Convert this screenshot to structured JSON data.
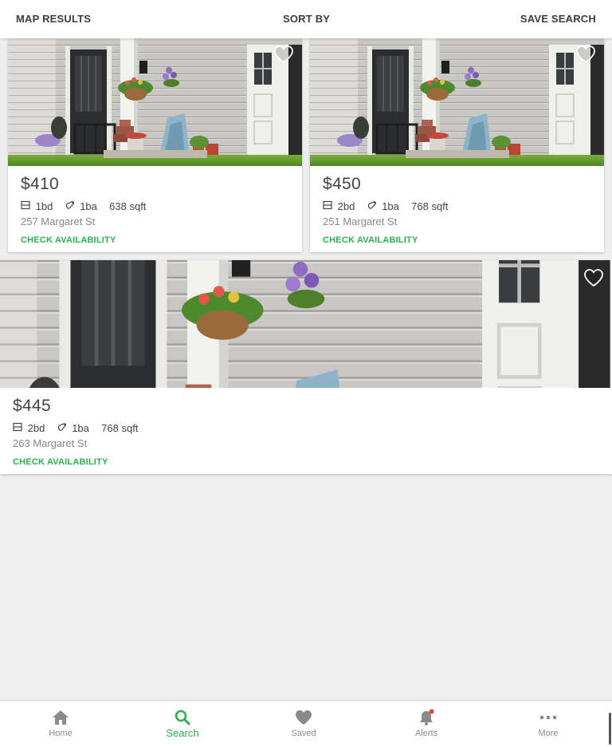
{
  "topbar": {
    "map_results": "MAP RESULTS",
    "sort_by": "SORT BY",
    "save_search": "SAVE SEARCH"
  },
  "listings": [
    {
      "price": "$410",
      "beds": "1bd",
      "baths": "1ba",
      "sqft": "638 sqft",
      "address": "257 Margaret St",
      "cta": "CHECK AVAILABILITY",
      "favorite_icon": "heart-outline-icon"
    },
    {
      "price": "$450",
      "beds": "2bd",
      "baths": "1ba",
      "sqft": "768 sqft",
      "address": "251 Margaret St",
      "cta": "CHECK AVAILABILITY",
      "favorite_icon": "heart-outline-icon"
    },
    {
      "price": "$445",
      "beds": "2bd",
      "baths": "1ba",
      "sqft": "768 sqft",
      "address": "263 Margaret St",
      "cta": "CHECK AVAILABILITY",
      "favorite_icon": "heart-outline-icon"
    }
  ],
  "bottom_nav": {
    "items": [
      {
        "label": "Home",
        "icon": "home-icon"
      },
      {
        "label": "Search",
        "icon": "search-icon",
        "active": true
      },
      {
        "label": "Saved",
        "icon": "heart-icon"
      },
      {
        "label": "Alerts",
        "icon": "bell-icon",
        "has_notification_dot": true
      },
      {
        "label": "More",
        "icon": "more-icon"
      }
    ]
  },
  "colors": {
    "accent_green": "#28b44a",
    "notification_red": "#e8442e",
    "background": "#eeeeee"
  }
}
